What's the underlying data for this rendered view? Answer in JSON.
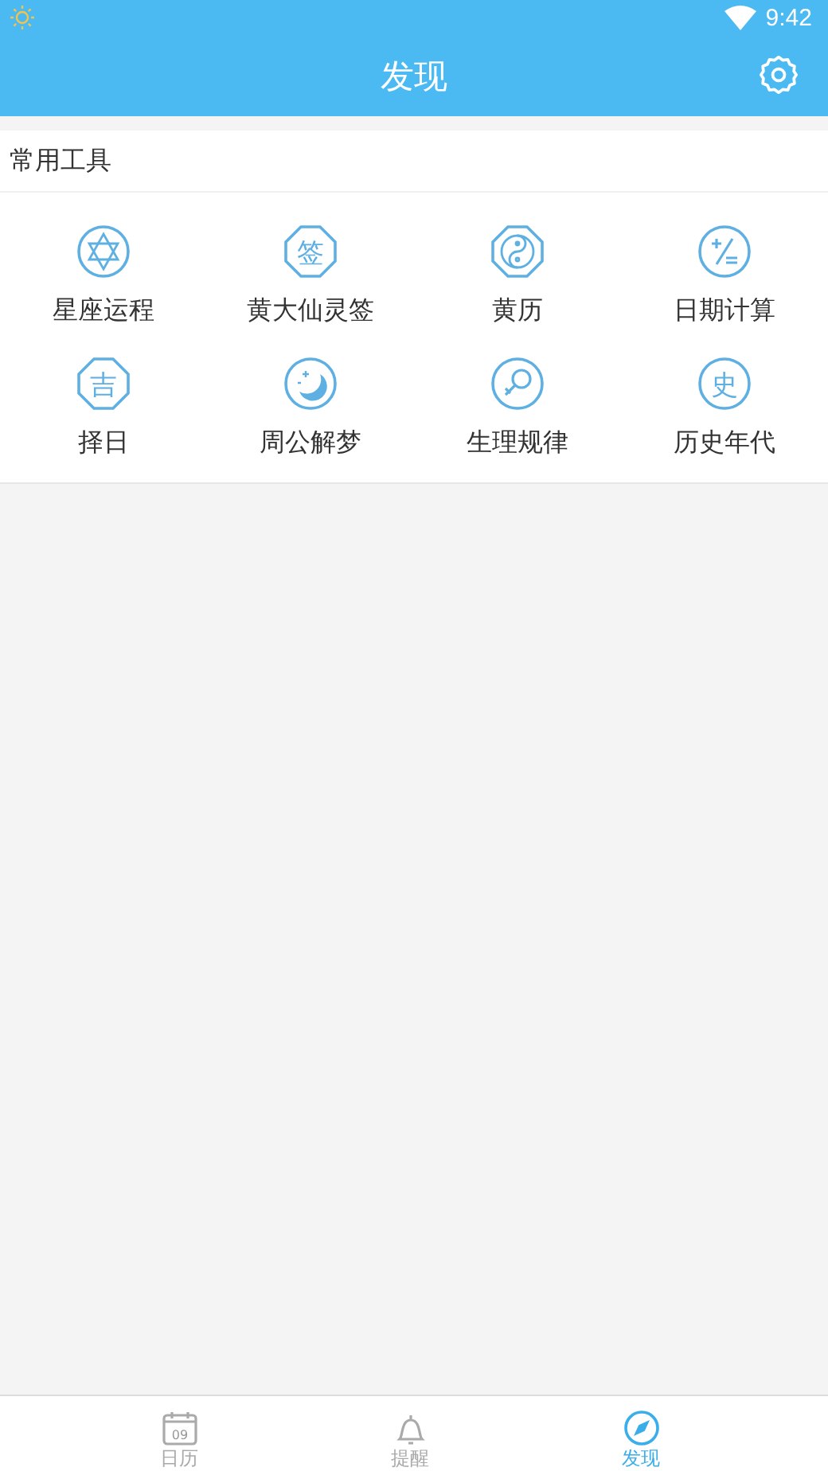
{
  "status_bar": {
    "time": "9:42"
  },
  "header": {
    "title": "发现"
  },
  "section": {
    "title": "常用工具"
  },
  "tools": [
    {
      "label": "星座运程",
      "kind": "hexagram"
    },
    {
      "label": "黄大仙灵签",
      "kind": "sealoct",
      "glyph": "签"
    },
    {
      "label": "黄历",
      "kind": "taiji"
    },
    {
      "label": "日期计算",
      "kind": "math"
    },
    {
      "label": "择日",
      "kind": "sealoct",
      "glyph": "吉"
    },
    {
      "label": "周公解梦",
      "kind": "moon"
    },
    {
      "label": "生理规律",
      "kind": "venus"
    },
    {
      "label": "历史年代",
      "kind": "sealround",
      "glyph": "史"
    }
  ],
  "bottom_nav": [
    {
      "label": "日历",
      "day": "09",
      "selected": false
    },
    {
      "label": "提醒",
      "selected": false
    },
    {
      "label": "发现",
      "selected": true
    }
  ]
}
